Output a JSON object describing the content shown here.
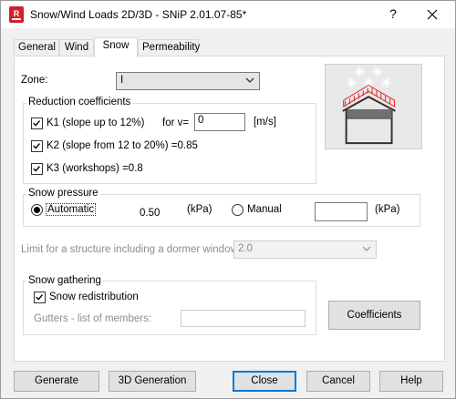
{
  "window": {
    "title": "Snow/Wind Loads 2D/3D - SNiP 2.01.07-85*",
    "help_glyph": "?",
    "close_icon": "close-icon",
    "app_icon_letter": "R",
    "app_icon_color": "#d0202a"
  },
  "tabs": [
    {
      "label": "General"
    },
    {
      "label": "Wind"
    },
    {
      "label": "Snow"
    },
    {
      "label": "Permeability"
    }
  ],
  "active_tab": "Snow",
  "zone": {
    "label": "Zone:",
    "value": "I"
  },
  "reduction": {
    "title": "Reduction coefficients",
    "k1": {
      "label": "K1 (slope up to 12%)",
      "checked": true
    },
    "for_v_label": "for v=",
    "v_value": "0",
    "v_unit": "[m/s]",
    "k2": {
      "label": "K2 (slope from 12 to 20%) =0.85",
      "checked": true
    },
    "k3": {
      "label": "K3 (workshops) =0.8",
      "checked": true
    }
  },
  "snow_pressure": {
    "title": "Snow pressure",
    "automatic_label": "Automatic",
    "automatic_selected": true,
    "value": "0.50",
    "unit": "(kPa)",
    "manual_label": "Manual",
    "manual_value": "",
    "manual_unit": "(kPa)"
  },
  "dormer": {
    "label": "Limit for a structure including a dormer window:",
    "value": "2.0"
  },
  "gathering": {
    "title": "Snow gathering",
    "redistribution_label": "Snow redistribution",
    "redistribution_checked": true,
    "gutters_label": "Gutters - list of members:",
    "gutters_value": ""
  },
  "coefficients_button": "Coefficients",
  "footer": {
    "generate": "Generate",
    "generation_3d": "3D Generation",
    "close": "Close",
    "cancel": "Cancel",
    "help": "Help"
  },
  "colors": {
    "accent": "#0078d7",
    "roof_load": "#e02020"
  }
}
